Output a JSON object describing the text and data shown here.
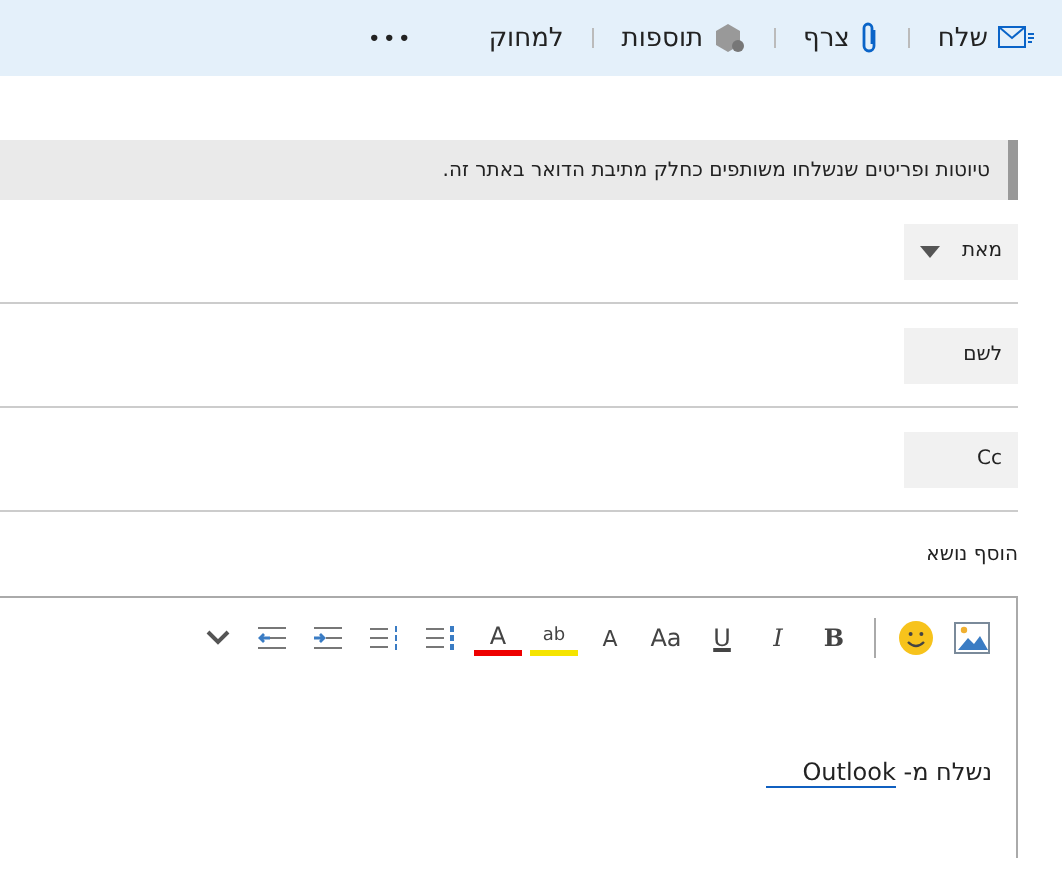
{
  "command_bar": [
    {
      "kind": "send",
      "label": "שלח"
    },
    {
      "kind": "attach",
      "label": "צרף"
    },
    {
      "kind": "addins",
      "label": "תוספות"
    },
    {
      "kind": "discard",
      "label": "למחוק"
    },
    {
      "kind": "more",
      "label": "•••"
    }
  ],
  "notice": "טיוטות ופריטים שנשלחו משותפים כחלק מתיבת הדואר באתר זה.",
  "fields": [
    {
      "kind": "dropdown",
      "label": "מאת"
    },
    {
      "kind": "recipients",
      "label": "לשם"
    },
    {
      "kind": "recipients",
      "label": "Cc"
    }
  ],
  "subject": {
    "placeholder": "הוסף נושא"
  },
  "toolbar": [
    {
      "kind": "image"
    },
    {
      "kind": "emoji"
    },
    {
      "kind": "separator"
    },
    {
      "kind": "bold",
      "label": "B"
    },
    {
      "kind": "italic",
      "label": "I"
    },
    {
      "kind": "underline",
      "label": "U"
    },
    {
      "kind": "font",
      "label": "Aa"
    },
    {
      "kind": "size",
      "label": "A"
    },
    {
      "kind": "highlight",
      "label": "ab"
    },
    {
      "kind": "color",
      "label": "A"
    },
    {
      "kind": "bullets"
    },
    {
      "kind": "numbering"
    },
    {
      "kind": "outdent"
    },
    {
      "kind": "indent"
    },
    {
      "kind": "expand"
    }
  ],
  "signature": {
    "text": "נשלח מ-",
    "link": "Outlook"
  }
}
